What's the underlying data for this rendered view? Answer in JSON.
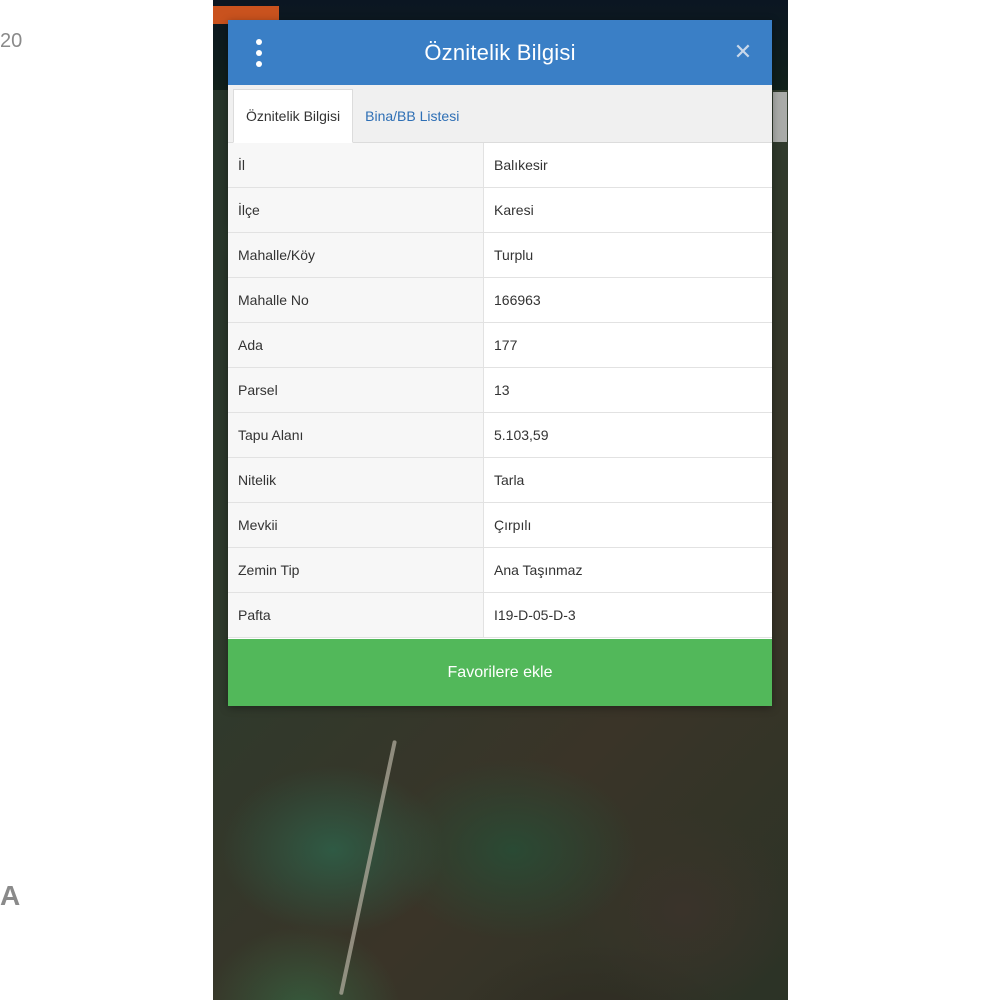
{
  "side": {
    "top_text": "20",
    "bottom_text": "A"
  },
  "dialog": {
    "title": "Öznitelik Bilgisi",
    "menu_icon": "more-vertical-icon",
    "close_symbol": "✕"
  },
  "tabs": [
    {
      "label": "Öznitelik Bilgisi",
      "active": true
    },
    {
      "label": "Bina/BB Listesi",
      "active": false
    }
  ],
  "attributes": [
    {
      "key": "İl",
      "value": "Balıkesir"
    },
    {
      "key": "İlçe",
      "value": "Karesi"
    },
    {
      "key": "Mahalle/Köy",
      "value": "Turplu"
    },
    {
      "key": "Mahalle No",
      "value": "166963"
    },
    {
      "key": "Ada",
      "value": "177"
    },
    {
      "key": "Parsel",
      "value": "13"
    },
    {
      "key": "Tapu Alanı",
      "value": "5.103,59"
    },
    {
      "key": "Nitelik",
      "value": "Tarla"
    },
    {
      "key": "Mevkii",
      "value": "Çırpılı"
    },
    {
      "key": "Zemin Tip",
      "value": "Ana Taşınmaz"
    },
    {
      "key": "Pafta",
      "value": "I19-D-05-D-3"
    }
  ],
  "favorite_button": {
    "label": "Favorilere ekle"
  },
  "colors": {
    "header": "#3a7fc6",
    "button": "#52b85a",
    "tab_link": "#2e6fb5"
  }
}
